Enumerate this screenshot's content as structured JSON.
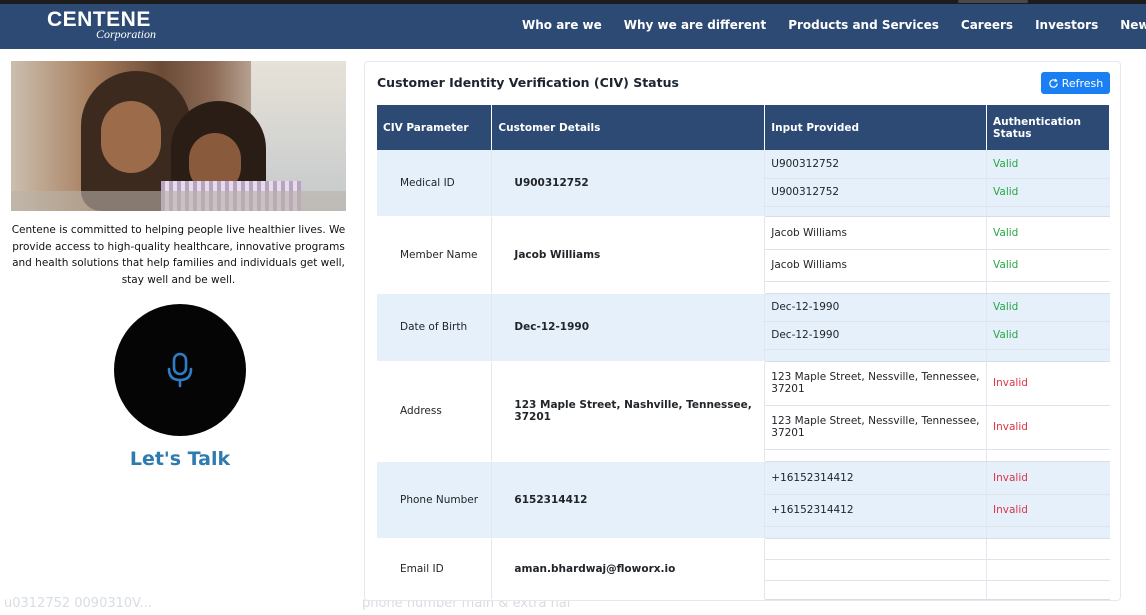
{
  "header": {
    "logo_main": "CENTENE",
    "logo_sub": "Corporation",
    "nav": [
      "Who are we",
      "Why we are different",
      "Products and Services",
      "Careers",
      "Investors",
      "News"
    ]
  },
  "sidebar": {
    "about": "Centene is committed to helping people live healthier lives. We provide access to high-quality healthcare, innovative programs and health solutions that help families and individuals get well, stay well and be well.",
    "mic_icon": "microphone-icon",
    "talk_label": "Let's Talk"
  },
  "panel": {
    "title": "Customer Identity Verification (CIV) Status",
    "refresh_label": "Refresh",
    "columns": [
      "CIV Parameter",
      "Customer Details",
      "Input Provided",
      "Authentication Status"
    ],
    "rows": [
      {
        "param": "Medical ID",
        "detail": "U900312752",
        "inputs": [
          {
            "value": "U900312752",
            "status": "Valid"
          },
          {
            "value": "U900312752",
            "status": "Valid"
          }
        ]
      },
      {
        "param": "Member Name",
        "detail": "Jacob Williams",
        "inputs": [
          {
            "value": "Jacob Williams",
            "status": "Valid"
          },
          {
            "value": "Jacob Williams",
            "status": "Valid"
          }
        ]
      },
      {
        "param": "Date of Birth",
        "detail": "Dec-12-1990",
        "inputs": [
          {
            "value": "Dec-12-1990",
            "status": "Valid"
          },
          {
            "value": "Dec-12-1990",
            "status": "Valid"
          }
        ]
      },
      {
        "param": "Address",
        "detail": "123 Maple Street, Nashville, Tennessee, 37201",
        "inputs": [
          {
            "value": "123 Maple Street, Nessville, Tennessee, 37201",
            "status": "Invalid"
          },
          {
            "value": "123 Maple Street, Nessville, Tennessee, 37201",
            "status": "Invalid"
          }
        ]
      },
      {
        "param": "Phone Number",
        "detail": "6152314412",
        "inputs": [
          {
            "value": "+16152314412",
            "status": "Invalid"
          },
          {
            "value": "+16152314412",
            "status": "Invalid"
          }
        ]
      },
      {
        "param": "Email ID",
        "detail": "aman.bhardwaj@floworx.io",
        "inputs": [
          {
            "value": "",
            "status": ""
          },
          {
            "value": "",
            "status": ""
          }
        ]
      }
    ]
  },
  "footer_faint": {
    "left": "u0312752   0090310V...",
    "right": "phone number main & extra hal"
  },
  "colors": {
    "nav_bg": "#2c4a73",
    "valid": "#28a745",
    "invalid": "#dc3545",
    "accent": "#1a7ff2",
    "talk": "#2e7bb0"
  }
}
